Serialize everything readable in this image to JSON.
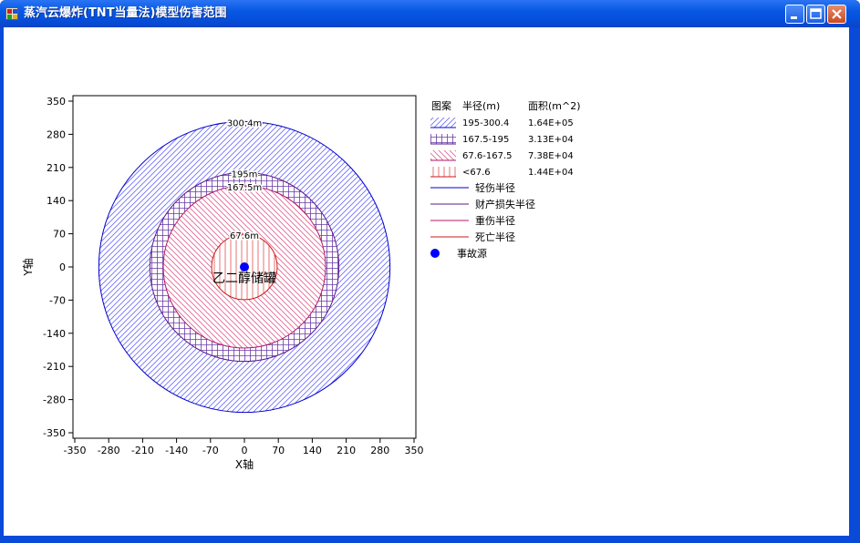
{
  "window": {
    "title": "蒸汽云爆炸(TNT当量法)模型伤害范围"
  },
  "colors": {
    "light_injury": "#0000cc",
    "property_loss": "#5a1a8a",
    "severe_injury": "#b0186a",
    "death": "#cc1a1a",
    "hatch_light": "#6a6aff",
    "hatch_property": "#6a3aa8",
    "hatch_severe": "#e06090",
    "hatch_death": "#e05050",
    "source": "#0000ff"
  },
  "chart_data": {
    "type": "scatter",
    "xlabel": "X轴",
    "ylabel": "Y轴",
    "xlim": [
      -350,
      350
    ],
    "ylim": [
      -350,
      350
    ],
    "xticks": [
      -350,
      -280,
      -210,
      -140,
      -70,
      0,
      70,
      140,
      210,
      280,
      350
    ],
    "yticks": [
      350,
      280,
      210,
      140,
      70,
      0,
      -70,
      -140,
      -210,
      -280,
      -350
    ],
    "grid": false,
    "legend_position": "right",
    "source": {
      "x": 0,
      "y": 0,
      "label": "乙二醇储罐"
    },
    "circles": [
      {
        "radius": 300.4,
        "label": "300.4m"
      },
      {
        "radius": 195,
        "label": "195m"
      },
      {
        "radius": 167.5,
        "label": "167.5m"
      },
      {
        "radius": 67.6,
        "label": "67.6m"
      }
    ]
  },
  "legend": {
    "headers": {
      "pattern": "图案",
      "radius": "半径(m)",
      "area": "面积(m^2)"
    },
    "rows": [
      {
        "range": "195-300.4",
        "area": "1.64E+05"
      },
      {
        "range": "167.5-195",
        "area": "3.13E+04"
      },
      {
        "range": "67.6-167.5",
        "area": "7.38E+04"
      },
      {
        "range": "<67.6",
        "area": "1.44E+04"
      }
    ],
    "lines": [
      {
        "label": "轻伤半径"
      },
      {
        "label": "财产损失半径"
      },
      {
        "label": "重伤半径"
      },
      {
        "label": "死亡半径"
      }
    ],
    "source_label": "事故源"
  }
}
